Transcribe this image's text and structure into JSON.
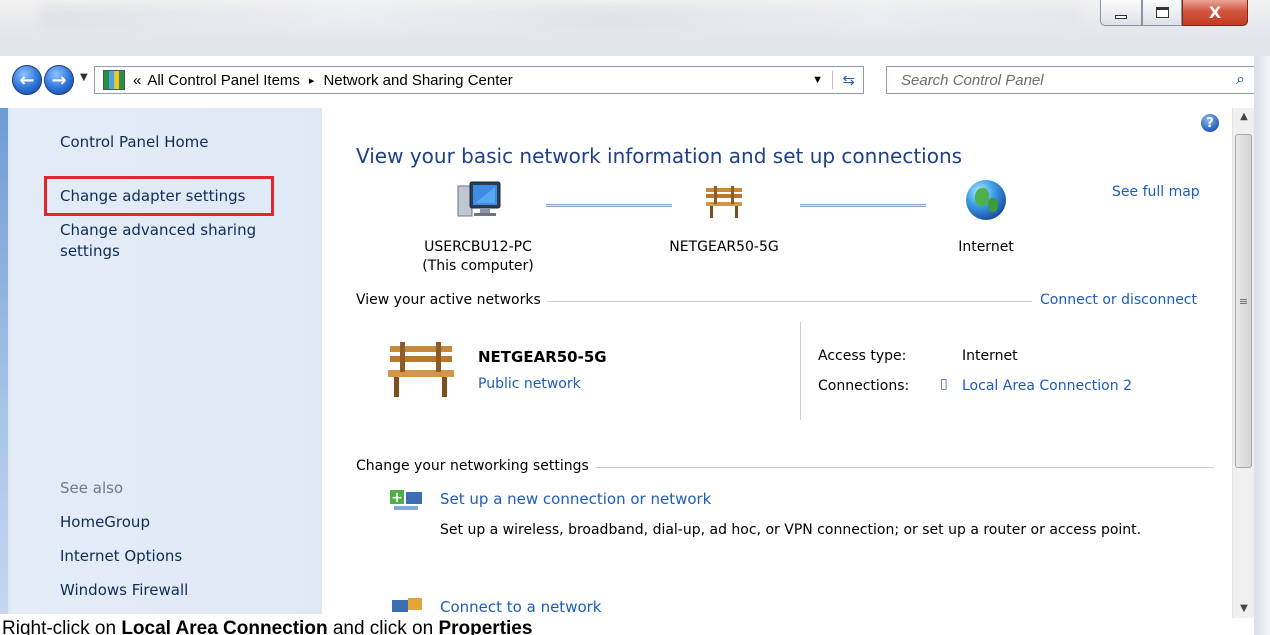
{
  "window": {
    "minimize_glyph": "",
    "maximize_glyph": "",
    "close_glyph": "X"
  },
  "address_bar": {
    "overflow_glyph": "«",
    "crumbs": [
      "All Control Panel Items",
      "Network and Sharing Center"
    ],
    "separator": "▸"
  },
  "search": {
    "placeholder": "Search Control Panel"
  },
  "left_nav": {
    "home": "Control Panel Home",
    "change_adapter": "Change adapter settings",
    "change_sharing_line1": "Change advanced sharing",
    "change_sharing_line2": "settings",
    "see_also_heading": "See also",
    "see_also": [
      "HomeGroup",
      "Internet Options",
      "Windows Firewall"
    ]
  },
  "main": {
    "heading": "View your basic network information and set up connections",
    "see_full_map": "See full map",
    "map": {
      "computer_name": "USERCBU12-PC",
      "computer_sub": "(This computer)",
      "router": "NETGEAR50-5G",
      "internet": "Internet"
    },
    "active_networks_title": "View your active networks",
    "connect_or_disconnect": "Connect or disconnect",
    "network": {
      "name": "NETGEAR50-5G",
      "type": "Public network",
      "access_type_label": "Access type:",
      "access_type_value": "Internet",
      "connections_label": "Connections:",
      "connections_value": "Local Area Connection 2"
    },
    "change_settings_title": "Change your networking settings",
    "tasks": [
      {
        "link": "Set up a new connection or network",
        "desc": "Set up a wireless, broadband, dial-up, ad hoc, or VPN connection; or set up a router or access point."
      },
      {
        "link": "Connect to a network",
        "desc": ""
      }
    ]
  },
  "caption": {
    "part1": "Right-click on ",
    "bold1": "Local Area Connection",
    "part2": " and click on ",
    "bold2": "Properties"
  },
  "colors": {
    "link": "#1b5dbf",
    "heading": "#1e3f8a",
    "highlight": "#e3262b",
    "nav_bg": "#dfe9f6"
  }
}
